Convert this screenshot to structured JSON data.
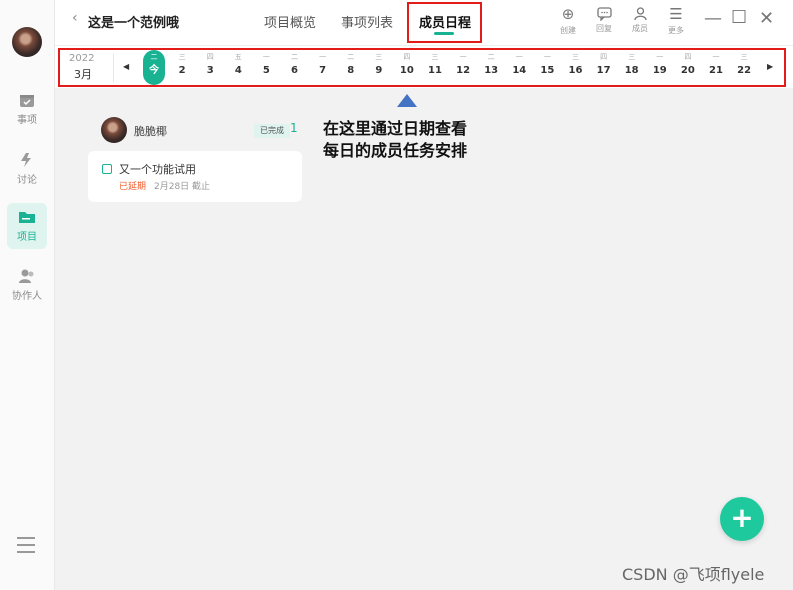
{
  "sidebar": {
    "items": [
      {
        "label": "事项",
        "icon": "calendar-check-icon",
        "active": false
      },
      {
        "label": "讨论",
        "icon": "discussion-icon",
        "active": false
      },
      {
        "label": "项目",
        "icon": "folder-icon",
        "active": true
      },
      {
        "label": "协作人",
        "icon": "people-icon",
        "active": false
      }
    ],
    "menu_icon": "hamburger-icon"
  },
  "header": {
    "back_glyph": "‹",
    "project_title": "这是一个范例哦",
    "tabs": [
      {
        "label": "项目概览"
      },
      {
        "label": "事项列表"
      },
      {
        "label": "成员日程"
      }
    ],
    "actions": [
      {
        "label": "创建",
        "icon": "plus-circle-icon"
      },
      {
        "label": "回复",
        "icon": "comment-icon"
      },
      {
        "label": "成员",
        "icon": "members-icon"
      },
      {
        "label": "更多",
        "icon": "more-icon"
      }
    ]
  },
  "date_strip": {
    "year": "2022",
    "month": "3月",
    "days": [
      {
        "wk": "二",
        "num": "今"
      },
      {
        "wk": "三",
        "num": "2"
      },
      {
        "wk": "四",
        "num": "3"
      },
      {
        "wk": "五",
        "num": "4"
      },
      {
        "wk": "一",
        "num": "5"
      },
      {
        "wk": "二",
        "num": "6"
      },
      {
        "wk": "一",
        "num": "7"
      },
      {
        "wk": "二",
        "num": "8"
      },
      {
        "wk": "三",
        "num": "9"
      },
      {
        "wk": "四",
        "num": "10"
      },
      {
        "wk": "三",
        "num": "11"
      },
      {
        "wk": "一",
        "num": "12"
      },
      {
        "wk": "二",
        "num": "13"
      },
      {
        "wk": "一",
        "num": "14"
      },
      {
        "wk": "一",
        "num": "15"
      },
      {
        "wk": "三",
        "num": "16"
      },
      {
        "wk": "四",
        "num": "17"
      },
      {
        "wk": "三",
        "num": "18"
      },
      {
        "wk": "一",
        "num": "19"
      },
      {
        "wk": "四",
        "num": "20"
      },
      {
        "wk": "一",
        "num": "21"
      },
      {
        "wk": "三",
        "num": "22"
      }
    ]
  },
  "annotation": {
    "line1": "在这里通过日期查看",
    "line2": "每日的成员任务安排"
  },
  "member": {
    "name": "脆脆椰",
    "done_label": "已完成",
    "done_count": "1"
  },
  "task": {
    "title": "又一个功能试用",
    "status": "已延期",
    "due": "2月28日 截止"
  },
  "fab_label": "+",
  "watermark": "CSDN @飞项flyele",
  "colors": {
    "accent": "#19b394",
    "highlight_box": "#e31b1b",
    "overdue": "#f05a28",
    "pointer": "#4472c4"
  }
}
